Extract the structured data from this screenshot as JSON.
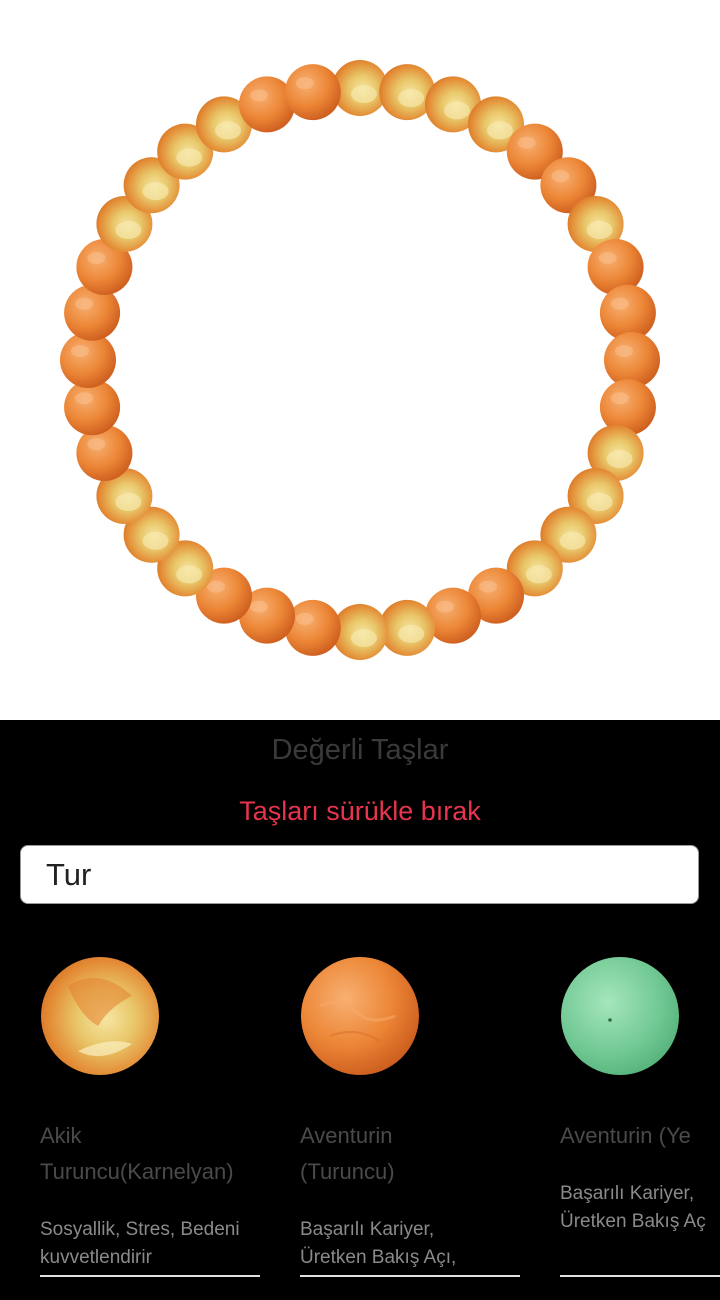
{
  "bracelet": {
    "bead_count": 36,
    "beads": [
      "akik",
      "akik",
      "akik",
      "akik",
      "aventurin-orange",
      "aventurin-orange",
      "akik",
      "aventurin-orange",
      "aventurin-orange",
      "aventurin-orange",
      "aventurin-orange",
      "akik",
      "akik",
      "akik",
      "akik",
      "aventurin-orange",
      "aventurin-orange",
      "akik",
      "akik",
      "aventurin-orange",
      "aventurin-orange",
      "aventurin-orange",
      "akik",
      "akik",
      "akik",
      "aventurin-orange",
      "aventurin-orange",
      "aventurin-orange",
      "aventurin-orange",
      "aventurin-orange",
      "akik",
      "akik",
      "akik",
      "akik",
      "aventurin-orange",
      "aventurin-orange"
    ]
  },
  "panel": {
    "title": "Değerli Taşlar",
    "subtitle": "Taşları sürükle bırak",
    "search_value": "Tur"
  },
  "stones": [
    {
      "type": "akik",
      "name_line1": "Akik",
      "name_line2": "Turuncu(Karnelyan)",
      "desc_line1": "Sosyallik, Stres, Bedeni",
      "desc_line2": "kuvvetlendirir"
    },
    {
      "type": "aventurin-orange",
      "name_line1": "Aventurin",
      "name_line2": "(Turuncu)",
      "desc_line1": "Başarılı Kariyer,",
      "desc_line2": "Üretken Bakış Açı,"
    },
    {
      "type": "aventurin-green",
      "name_line1": "Aventurin (Ye",
      "name_line2": "",
      "desc_line1": "Başarılı Kariyer,",
      "desc_line2": "Üretken Bakış Aç"
    }
  ],
  "colors": {
    "accent": "#e8344e",
    "akik_base": "#e07a28",
    "akik_light": "#f2dc8a",
    "aventurin_orange": "#ee8b3c",
    "aventurin_green": "#6ec893"
  }
}
